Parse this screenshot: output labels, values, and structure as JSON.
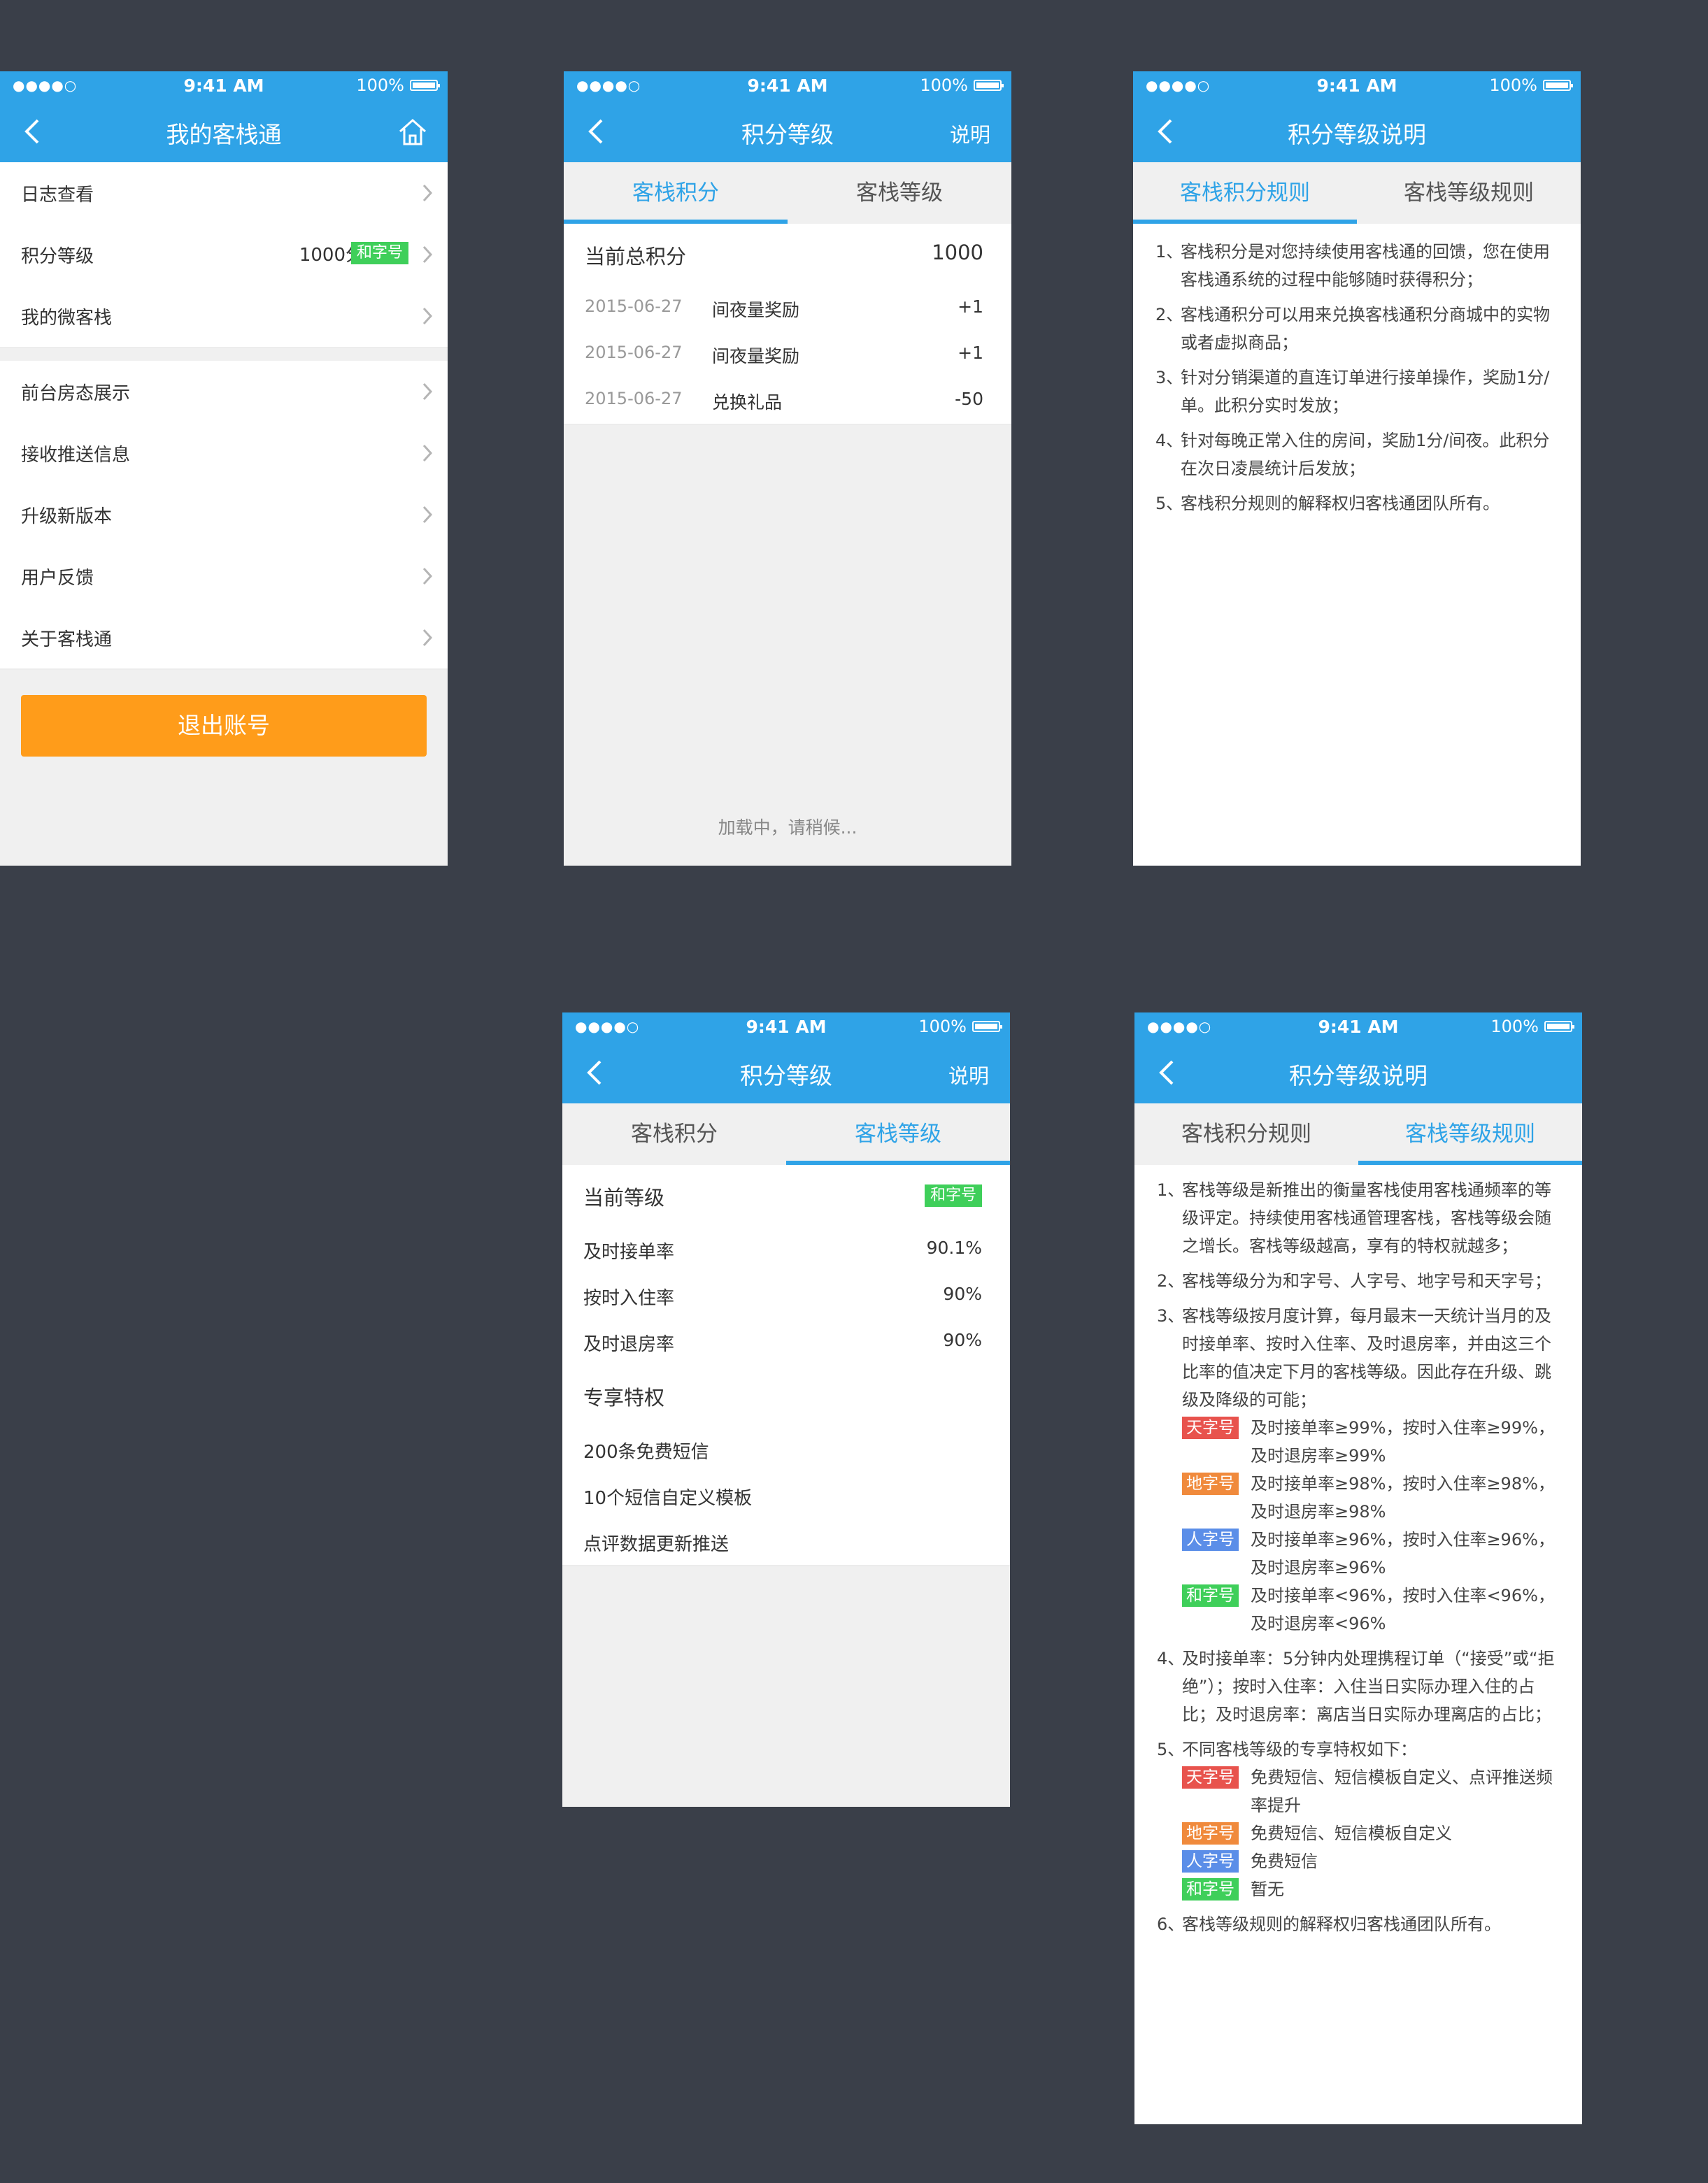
{
  "status": {
    "signal": "●●●●○",
    "time": "9:41 AM",
    "battery": "100%"
  },
  "screen1": {
    "title": "我的客栈通",
    "group1": [
      {
        "label": "日志查看"
      },
      {
        "label": "积分等级",
        "value": "1000分",
        "badge": "和字号"
      },
      {
        "label": "我的微客栈"
      }
    ],
    "group2": [
      {
        "label": "前台房态展示"
      },
      {
        "label": "接收推送信息"
      },
      {
        "label": "升级新版本"
      },
      {
        "label": "用户反馈"
      },
      {
        "label": "关于客栈通"
      }
    ],
    "logout_label": "退出账号"
  },
  "screen2": {
    "title": "积分等级",
    "right": "说明",
    "tabs": [
      "客栈积分",
      "客栈等级"
    ],
    "total_label": "当前总积分",
    "total_value": "1000",
    "records": [
      {
        "date": "2015-06-27",
        "desc": "间夜量奖励",
        "points": "+1"
      },
      {
        "date": "2015-06-27",
        "desc": "间夜量奖励",
        "points": "+1"
      },
      {
        "date": "2015-06-27",
        "desc": "兑换礼品",
        "points": "-50"
      }
    ],
    "loading": "加载中，请稍候..."
  },
  "screen3": {
    "title": "积分等级说明",
    "tabs": [
      "客栈积分规则",
      "客栈等级规则"
    ],
    "rules": [
      {
        "num": "1、",
        "text": "客栈积分是对您持续使用客栈通的回馈，您在使用客栈通系统的过程中能够随时获得积分；"
      },
      {
        "num": "2、",
        "text": "客栈通积分可以用来兑换客栈通积分商城中的实物或者虚拟商品；"
      },
      {
        "num": "3、",
        "text": "针对分销渠道的直连订单进行接单操作，奖励1分/单。此积分实时发放；"
      },
      {
        "num": "4、",
        "text": "针对每晚正常入住的房间，奖励1分/间夜。此积分在次日凌晨统计后发放；"
      },
      {
        "num": "5、",
        "text": "客栈积分规则的解释权归客栈通团队所有。"
      }
    ]
  },
  "screen4": {
    "title": "积分等级",
    "right": "说明",
    "tabs": [
      "客栈积分",
      "客栈等级"
    ],
    "level_label": "当前等级",
    "level_badge": "和字号",
    "stats": [
      {
        "label": "及时接单率",
        "value": "90.1%"
      },
      {
        "label": "按时入住率",
        "value": "90%"
      },
      {
        "label": "及时退房率",
        "value": "90%"
      }
    ],
    "privilege_title": "专享特权",
    "privileges": [
      "200条免费短信",
      "10个短信自定义模板",
      "点评数据更新推送"
    ]
  },
  "screen5": {
    "title": "积分等级说明",
    "tabs": [
      "客栈积分规则",
      "客栈等级规则"
    ],
    "r1_num": "1、",
    "r1": "客栈等级是新推出的衡量客栈使用客栈通频率的等级评定。持续使用客栈通管理客栈，客栈等级会随之增长。客栈等级越高，享有的特权就越多；",
    "r2_num": "2、",
    "r2": "客栈等级分为和字号、人字号、地字号和天字号；",
    "r3_num": "3、",
    "r3": "客栈等级按月度计算，每月最末一天统计当月的及时接单率、按时入住率、及时退房率，并由这三个比率的值决定下月的客栈等级。因此存在升级、跳级及降级的可能；",
    "r3_items": [
      {
        "badge": "天字号",
        "color": "#e8534d",
        "text": "及时接单率≥99%，按时入住率≥99%，及时退房率≥99%"
      },
      {
        "badge": "地字号",
        "color": "#f08a3c",
        "text": "及时接单率≥98%，按时入住率≥98%，及时退房率≥98%"
      },
      {
        "badge": "人字号",
        "color": "#5b8ee8",
        "text": "及时接单率≥96%，按时入住率≥96%，及时退房率≥96%"
      },
      {
        "badge": "和字号",
        "color": "#3fcf5a",
        "text": "及时接单率<96%，按时入住率<96%，及时退房率<96%"
      }
    ],
    "r4_num": "4、",
    "r4": "及时接单率：5分钟内处理携程订单（“接受”或“拒绝”）；按时入住率：入住当日实际办理入住的占比；及时退房率：离店当日实际办理离店的占比；",
    "r5_num": "5、",
    "r5": "不同客栈等级的专享特权如下：",
    "r5_items": [
      {
        "badge": "天字号",
        "color": "#e8534d",
        "text": "免费短信、短信模板自定义、点评推送频率提升"
      },
      {
        "badge": "地字号",
        "color": "#f08a3c",
        "text": "免费短信、短信模板自定义"
      },
      {
        "badge": "人字号",
        "color": "#5b8ee8",
        "text": "免费短信"
      },
      {
        "badge": "和字号",
        "color": "#3fcf5a",
        "text": "暂无"
      }
    ],
    "r6_num": "6、",
    "r6": "客栈等级规则的解释权归客栈通团队所有。"
  }
}
